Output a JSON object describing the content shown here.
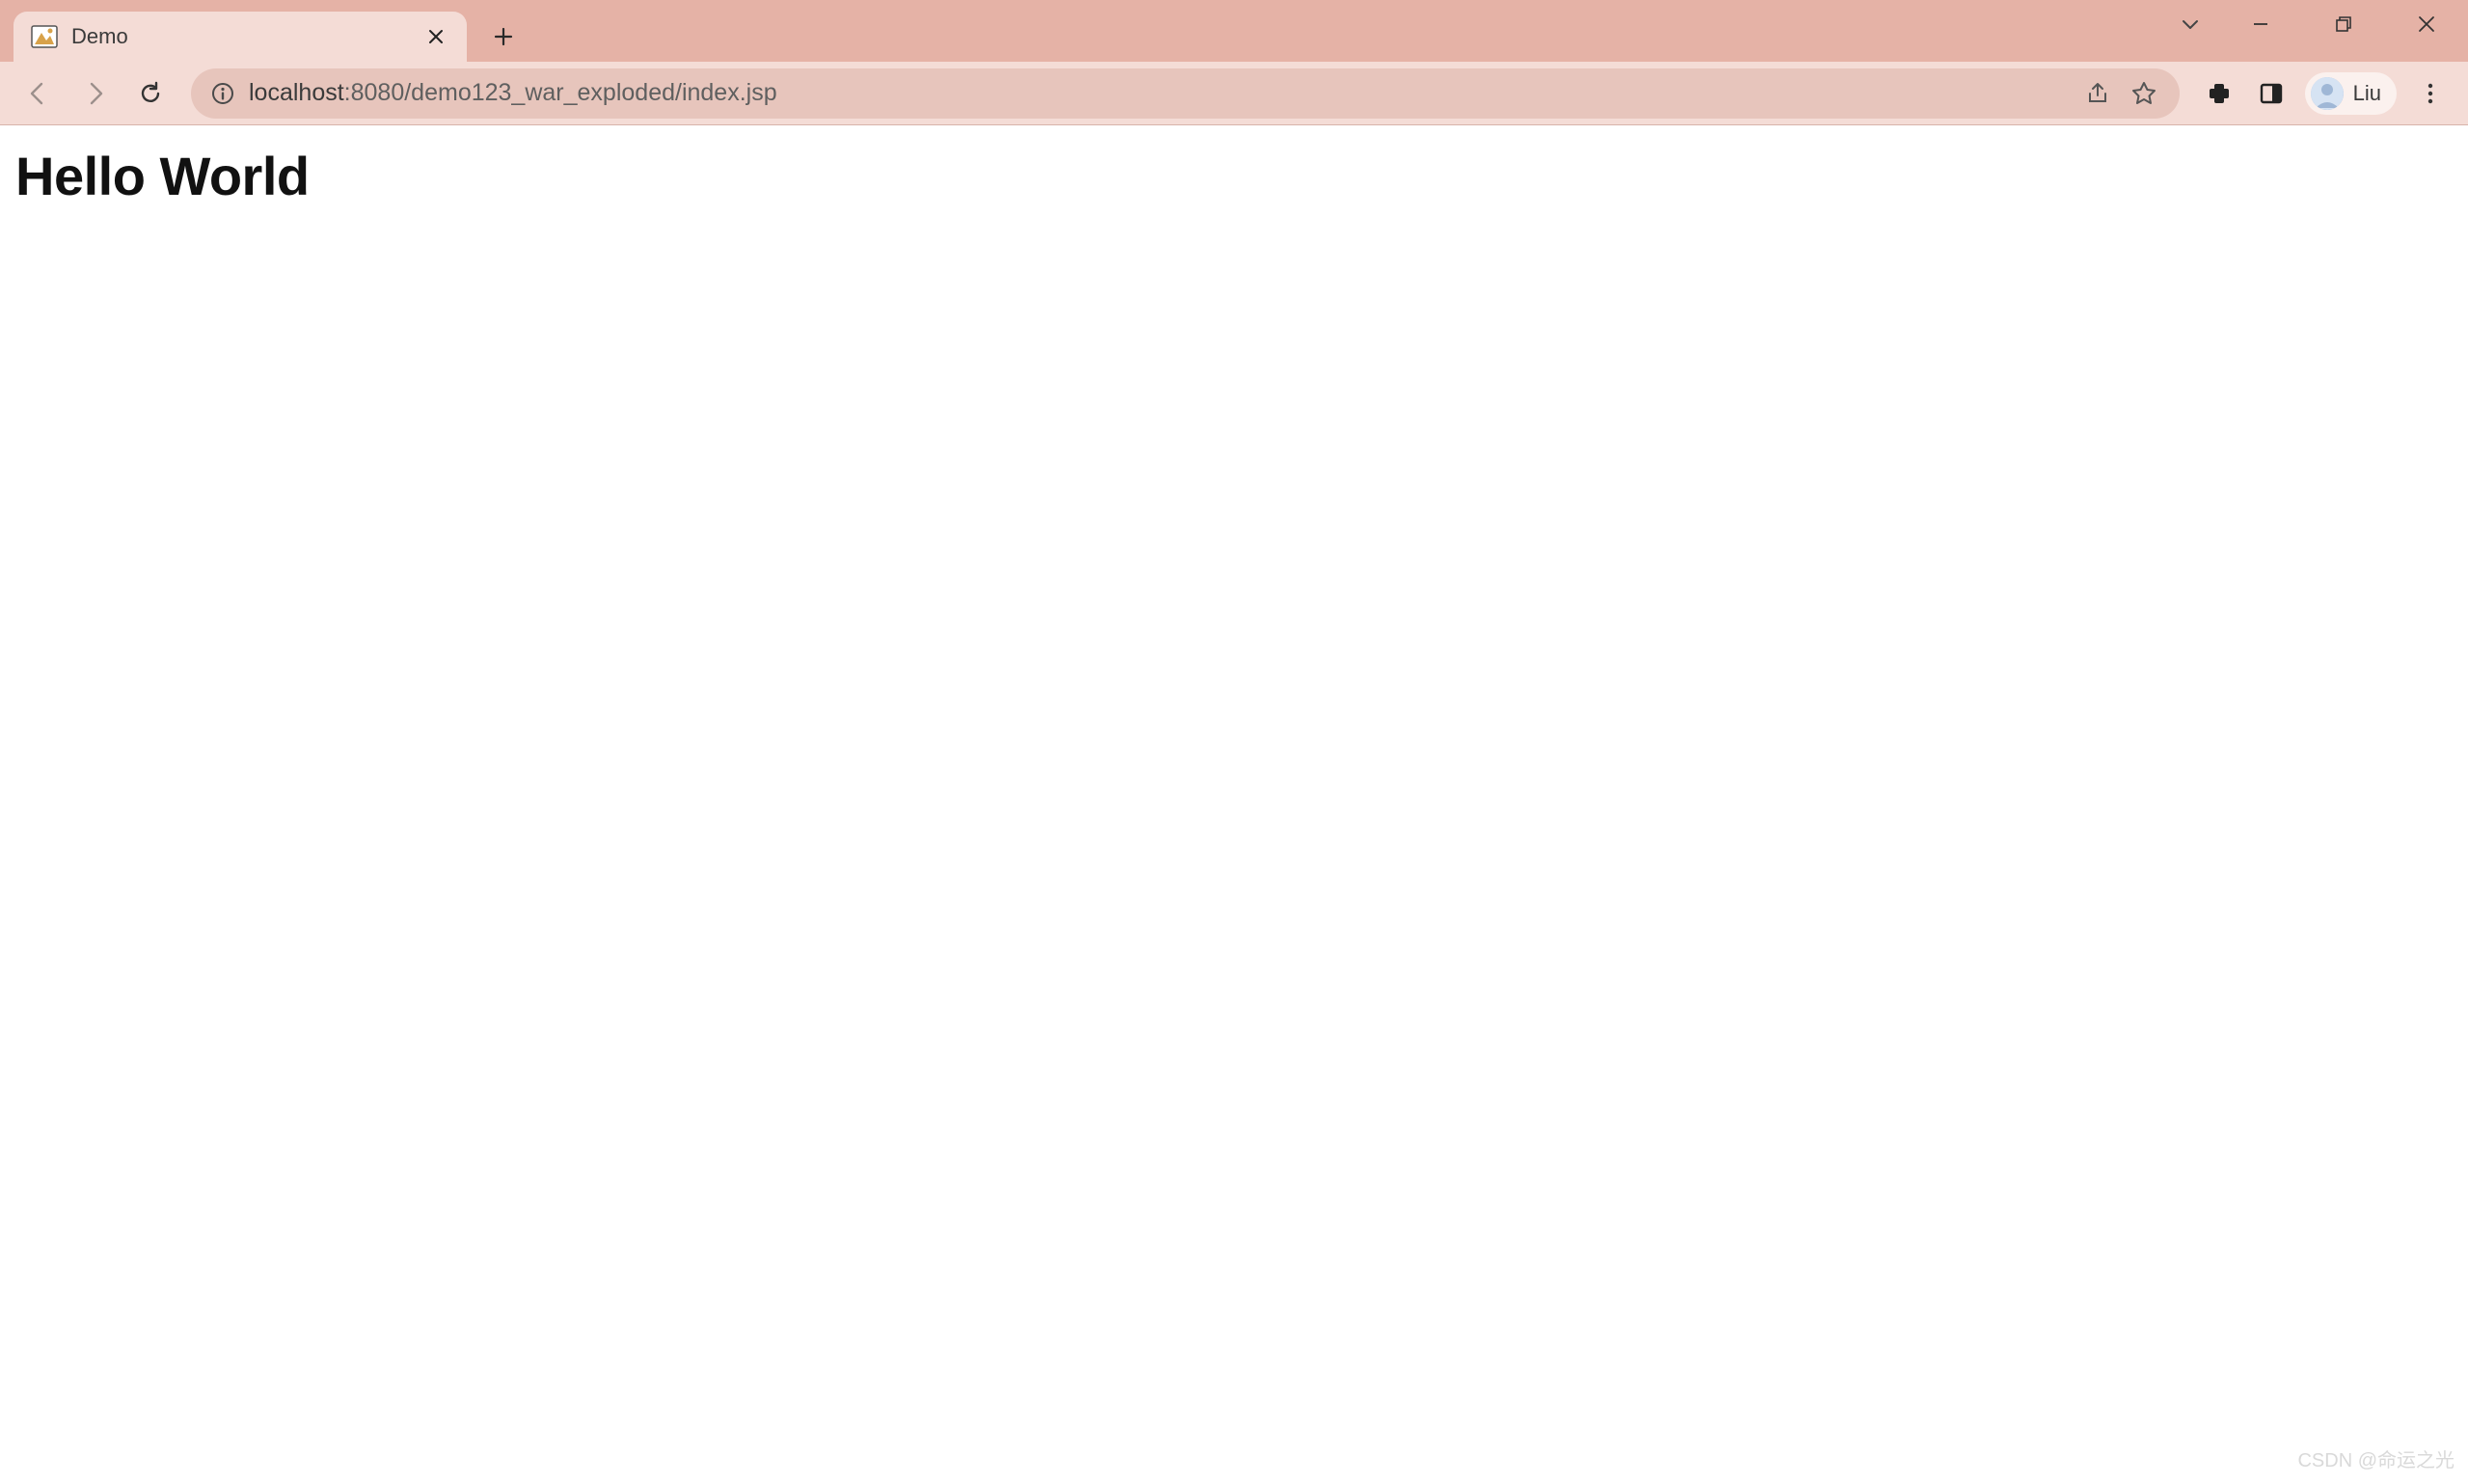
{
  "titlebar": {
    "tab": {
      "title": "Demo"
    }
  },
  "toolbar": {
    "url": {
      "host": "localhost",
      "port": ":8080",
      "path": "/demo123_war_exploded/index.jsp"
    },
    "profile": {
      "name": "Liu"
    }
  },
  "page": {
    "heading": "Hello World"
  },
  "watermark": "CSDN @命运之光"
}
